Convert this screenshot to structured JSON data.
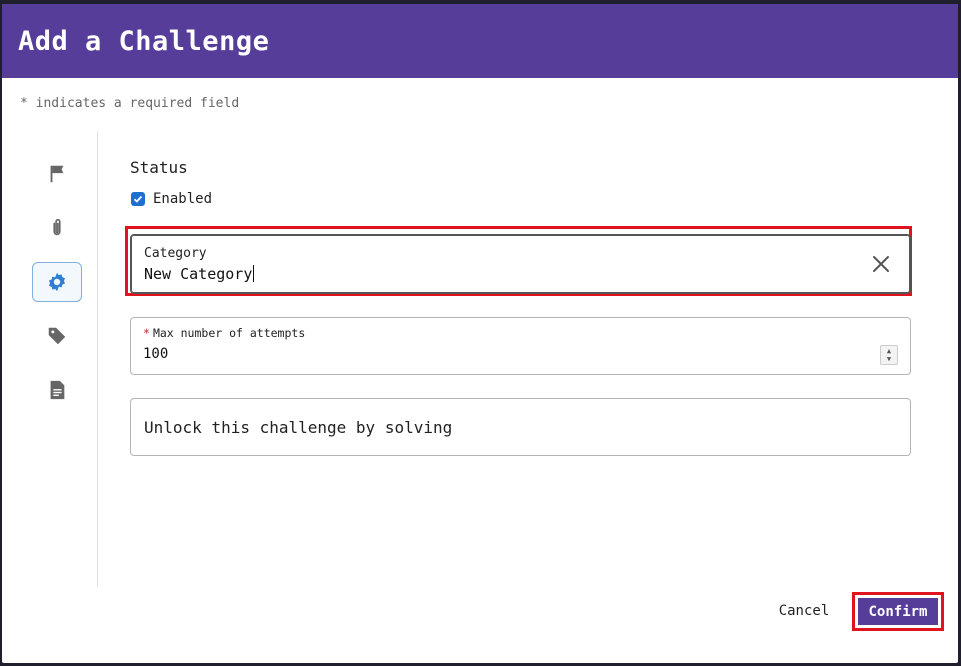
{
  "dialog": {
    "title": "Add a Challenge",
    "required_note": "* indicates a required field"
  },
  "sidebar": {
    "items": [
      {
        "icon": "flag-icon",
        "active": false
      },
      {
        "icon": "paperclip-icon",
        "active": false
      },
      {
        "icon": "gear-icon",
        "active": true
      },
      {
        "icon": "tag-icon",
        "active": false
      },
      {
        "icon": "document-icon",
        "active": false
      }
    ]
  },
  "form": {
    "status": {
      "label": "Status",
      "checkbox_label": "Enabled",
      "checked": true
    },
    "category": {
      "label": "Category",
      "value": "New Category"
    },
    "max_attempts": {
      "required_mark": "*",
      "label": "Max number of attempts",
      "value": "100"
    },
    "unlock": {
      "label": "Unlock this challenge by solving"
    }
  },
  "footer": {
    "cancel_label": "Cancel",
    "confirm_label": "Confirm"
  },
  "colors": {
    "header_bg": "#563d99",
    "highlight": "#e0141e",
    "checkbox": "#1f6fd1"
  }
}
